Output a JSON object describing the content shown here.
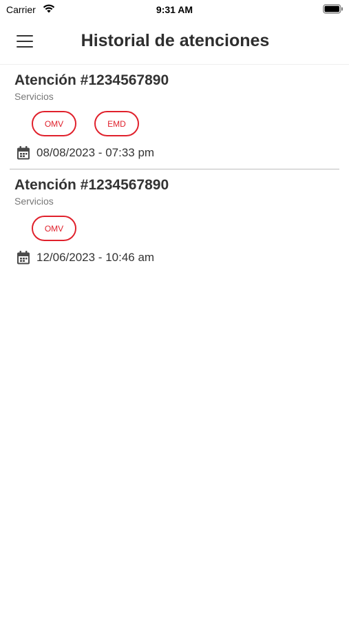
{
  "status_bar": {
    "carrier": "Carrier",
    "time": "9:31 AM",
    "icons": [
      "wifi-icon",
      "battery-icon"
    ]
  },
  "header": {
    "title": "Historial de atenciones",
    "menu_icon": "hamburger-menu-icon"
  },
  "colors": {
    "accent_red": "#e0202b",
    "text_dark": "#333333",
    "text_muted": "#777777",
    "divider": "#bdbdbd"
  },
  "attentions": [
    {
      "title": "Atención #1234567890",
      "subtitle": "Servicios",
      "tags": [
        "OMV",
        "EMD"
      ],
      "date": "08/08/2023 - 07:33 pm"
    },
    {
      "title": "Atención #1234567890",
      "subtitle": "Servicios",
      "tags": [
        "OMV"
      ],
      "date": "12/06/2023 - 10:46 am"
    }
  ]
}
